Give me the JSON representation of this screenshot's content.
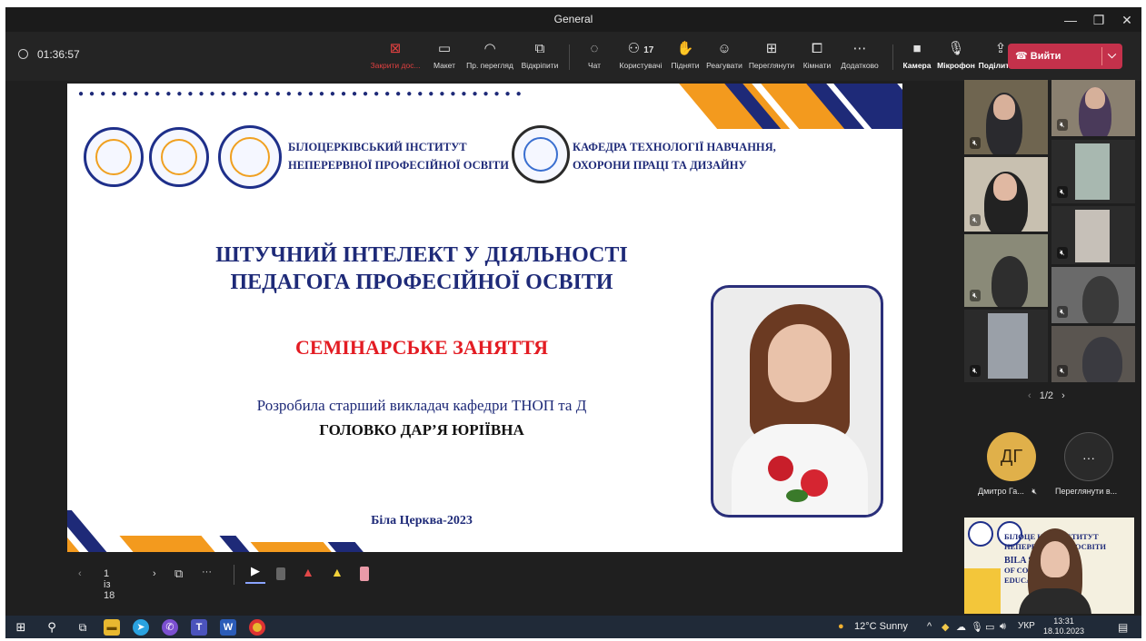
{
  "window": {
    "title": "General",
    "minimize": "—",
    "restore": "❐",
    "close": "✕"
  },
  "toolbar": {
    "timer": "01:36:57",
    "items": [
      {
        "label": "Закрити дос...",
        "icon": "⊠"
      },
      {
        "label": "Макет",
        "icon": "▭"
      },
      {
        "label": "Пр. перегляд",
        "icon": "◠"
      },
      {
        "label": "Відкріпити",
        "icon": "⧉"
      },
      {
        "label": "Чат",
        "icon": "◌"
      },
      {
        "label": "Користувачі",
        "icon": "⚇",
        "count": "17"
      },
      {
        "label": "Підняти",
        "icon": "✋"
      },
      {
        "label": "Реагувати",
        "icon": "☺"
      },
      {
        "label": "Переглянути",
        "icon": "⊞"
      },
      {
        "label": "Кімнати",
        "icon": "⧠"
      },
      {
        "label": "Додатково",
        "icon": "⋯"
      },
      {
        "label": "Камера",
        "icon": "■"
      },
      {
        "label": "Мікрофон",
        "icon": "🎙"
      },
      {
        "label": "Поділитися",
        "icon": "⇪"
      }
    ],
    "leave": {
      "label": "Вийти",
      "icon": "☎",
      "chevron": "⌵"
    }
  },
  "slide": {
    "institute_line1": "БІЛОЦЕРКІВСЬКИЙ ІНСТИТУТ",
    "institute_line2": "НЕПЕРЕРВНОЇ ПРОФЕСІЙНОЇ ОСВІТИ",
    "department_line1": "КАФЕДРА ТЕХНОЛОГІЇ НАВЧАННЯ,",
    "department_line2": "ОХОРОНИ ПРАЦІ ТА ДИЗАЙНУ",
    "title_line1": "ШТУЧНИЙ ІНТЕЛЕКТ У ДІЯЛЬНОСТІ",
    "title_line2": "ПЕДАГОГА ПРОФЕСІЙНОЇ ОСВІТИ",
    "subtitle": "СЕМІНАРСЬКЕ ЗАНЯТТЯ",
    "author_line1": "Розробила старший викладач кафедри ТНОП та Д",
    "author_line2": "ГОЛОВКО ДАР’Я ЮРІЇВНА",
    "city_year": "Біла Церква-2023",
    "colors": {
      "navy": "#1e2a78",
      "orange": "#f39a1e",
      "red": "#e31c23"
    }
  },
  "presenter_bar": {
    "page": "1 із 18",
    "prev": "‹",
    "next": "›",
    "more": "···"
  },
  "participants": {
    "pagination": "1/2",
    "avatar_initials": "ДГ",
    "avatar_name": "Дмитро Га...",
    "more_label": "Переглянути в...",
    "more_icon": "···"
  },
  "shared_preview": {
    "line1": "БІЛОЦЕ   КИЙ ІНСТИТУТ",
    "line2": "НЕПЕРЕ   ЕСІЙНОЇ ОСВІТИ",
    "line3": "BILA   STITUTE",
    "line4": "OF CO   FESSIONAL",
    "line5": "EDUCA"
  },
  "taskbar": {
    "weather": "12°C  Sunny",
    "lang": "УКР",
    "time": "13:31",
    "date": "18.10.2023"
  }
}
